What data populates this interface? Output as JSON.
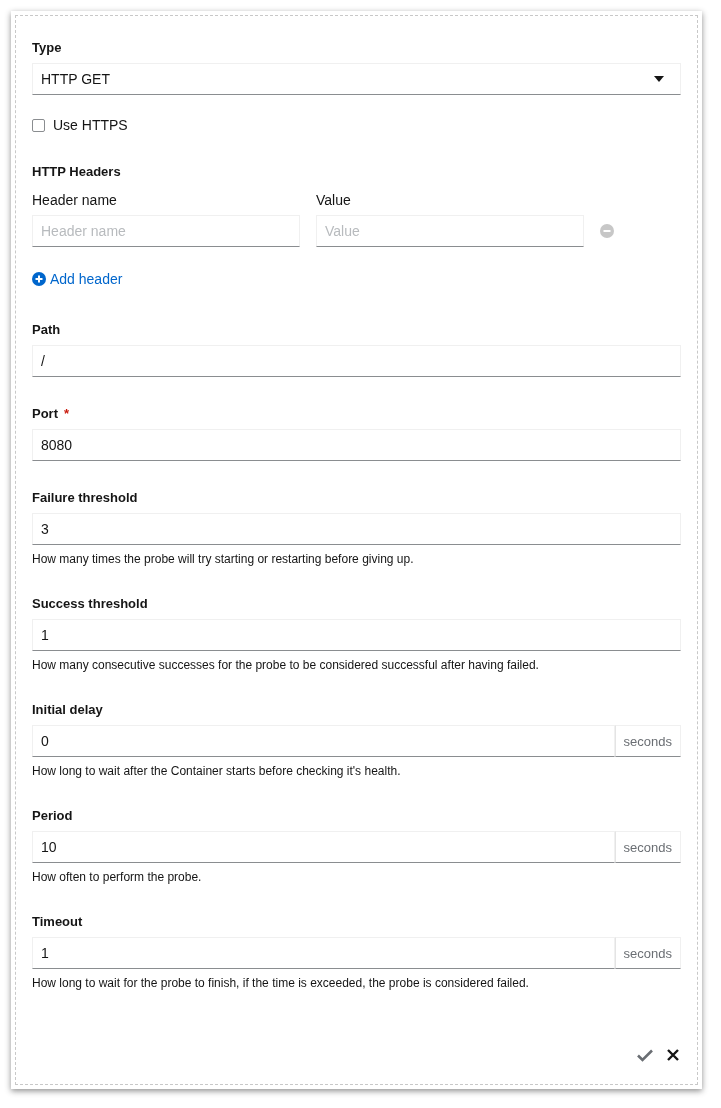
{
  "type_field": {
    "label": "Type",
    "value": "HTTP GET"
  },
  "use_https": {
    "label": "Use HTTPS",
    "checked": false
  },
  "http_headers": {
    "title": "HTTP Headers",
    "name_label": "Header name",
    "value_label": "Value",
    "rows": [
      {
        "name_placeholder": "Header name",
        "value_placeholder": "Value"
      }
    ],
    "add_label": "Add header"
  },
  "fields": [
    {
      "label": "Path",
      "value": "/"
    },
    {
      "label": "Port",
      "value": "8080",
      "required_mark": "*"
    },
    {
      "label": "Failure threshold",
      "value": "3",
      "help": "How many times the probe will try starting or restarting before giving up."
    },
    {
      "label": "Success threshold",
      "value": "1",
      "help": "How many consecutive successes for the probe to be considered successful after having failed."
    },
    {
      "label": "Initial delay",
      "value": "0",
      "suffix": "seconds",
      "help": "How long to wait after the Container starts before checking it's health."
    },
    {
      "label": "Period",
      "value": "10",
      "suffix": "seconds",
      "help": "How often to perform the probe."
    },
    {
      "label": "Timeout",
      "value": "1",
      "suffix": "seconds",
      "help": "How long to wait for the probe to finish, if the time is exceeded, the probe is considered failed."
    }
  ]
}
